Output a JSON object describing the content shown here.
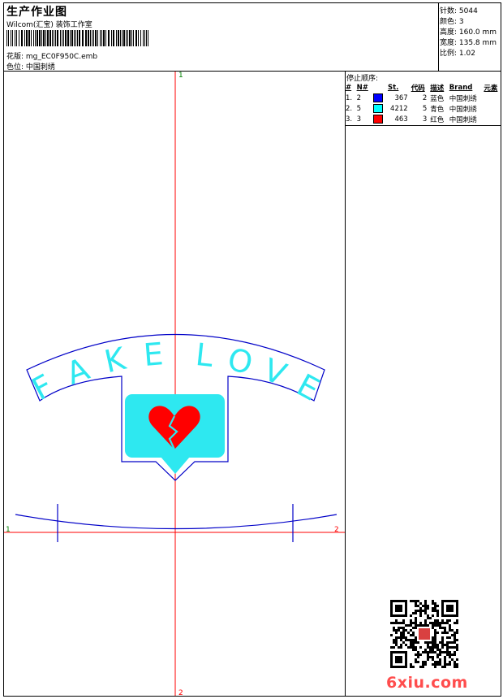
{
  "header": {
    "title": "生产作业图",
    "company": "Wilcom(汇宝) 装饰工作室",
    "design_label": "花版: mg_EC0F950C.emb",
    "position_label": "色位: 中国刺绣"
  },
  "stats": {
    "stitches": "针数: 5044",
    "colors": "颜色: 3",
    "height": "高度: 160.0 mm",
    "width": "宽度: 135.8 mm",
    "ratio": "比例: 1.02"
  },
  "stop_sequence": {
    "title": "停止顺序:",
    "columns": [
      "#",
      "N#",
      "St.",
      "代码",
      "描述",
      "Brand",
      "元素"
    ],
    "rows": [
      {
        "n": "1.",
        "needle": "2",
        "color": "#0000ff",
        "stitches": "367",
        "code": "2",
        "desc": "蓝色",
        "brand": "中国刺绣"
      },
      {
        "n": "2.",
        "needle": "5",
        "color": "#00ffff",
        "stitches": "4212",
        "code": "5",
        "desc": "青色",
        "brand": "中国刺绣"
      },
      {
        "n": "3.",
        "needle": "3",
        "color": "#ff0000",
        "stitches": "463",
        "code": "3",
        "desc": "红色",
        "brand": "中国刺绣"
      }
    ]
  },
  "design": {
    "text": "FAKE LOVE",
    "letters": [
      "F",
      "A",
      "K",
      "E",
      "L",
      "O",
      "V",
      "E"
    ],
    "outline_color": "#0000c8",
    "fill_color": "#2ee8f0",
    "heart_color": "#ff0000",
    "axis_color": "#ff0000"
  },
  "markers": {
    "top": "1",
    "bottom": "2",
    "left": "1",
    "right": "2"
  },
  "watermark": {
    "logo": "6xiu.com"
  }
}
